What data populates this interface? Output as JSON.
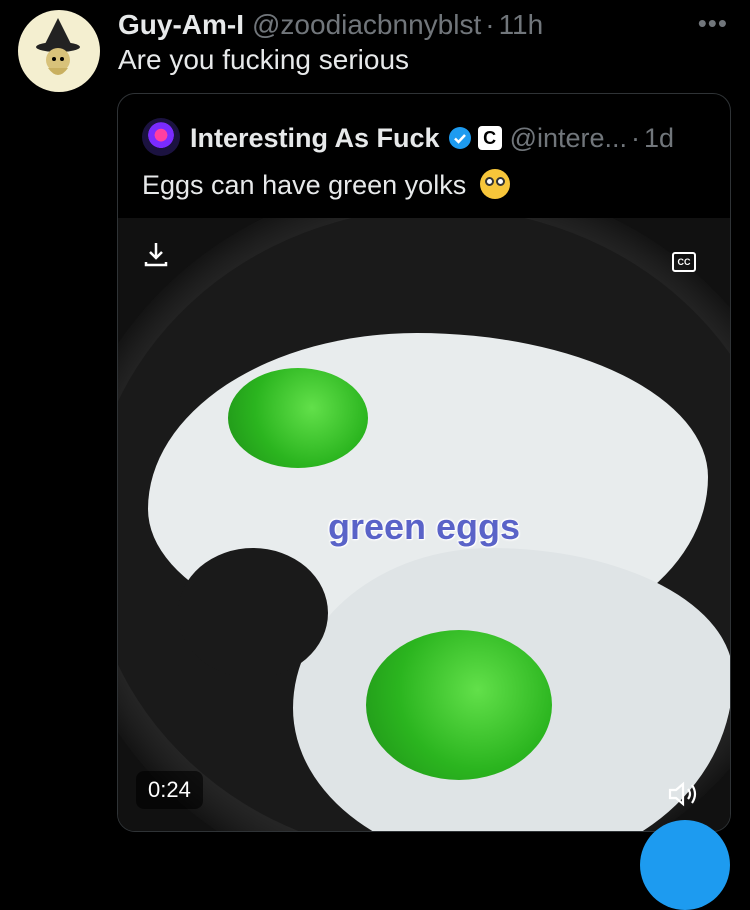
{
  "tweet": {
    "display_name": "Guy-Am-I",
    "handle": "@zoodiacbnnyblst",
    "separator": "·",
    "time": "11h",
    "text": "Are you fucking serious",
    "more_icon": "more-dots-icon"
  },
  "quote": {
    "display_name": "Interesting As Fuck",
    "verified_icon": "verified-badge-icon",
    "badge_letter": "C",
    "handle": "@intere...",
    "separator": "·",
    "time": "1d",
    "text": "Eggs can have green yolks",
    "emoji": "flushed-face-emoji"
  },
  "media": {
    "overlay_text": "green eggs",
    "duration": "0:24",
    "cc_label": "CC",
    "download_icon": "download-icon",
    "volume_icon": "volume-icon"
  },
  "colors": {
    "background": "#000000",
    "text": "#e7e9ea",
    "muted": "#71767b",
    "accent": "#1d9bf0",
    "yolk": "#2bb51f"
  }
}
